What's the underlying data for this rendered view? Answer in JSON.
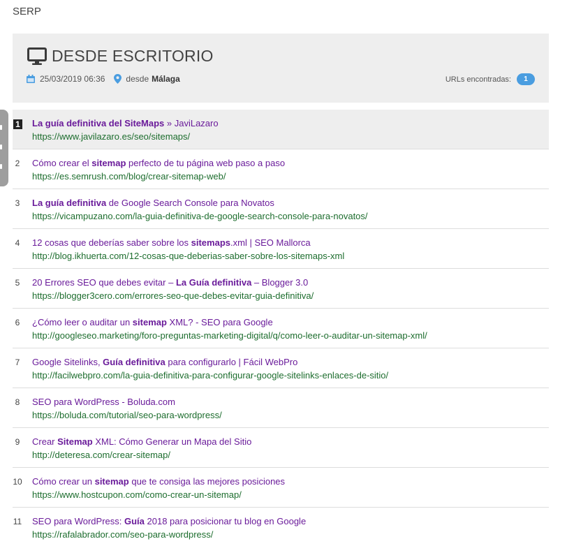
{
  "page": {
    "heading": "SERP"
  },
  "header": {
    "title": "DESDE ESCRITORIO",
    "date": "25/03/2019 06:36",
    "from_prefix": "desde",
    "location": "Málaga",
    "urls_label": "URLs encontradas:",
    "urls_count": "1"
  },
  "colors": {
    "badge": "#4a9de0",
    "title": "#6a1b9a",
    "url": "#1d6d2e",
    "panel": "#eeeeee"
  },
  "results": [
    {
      "number": "1",
      "title": [
        {
          "t": "La guía definitiva del SiteMaps",
          "b": true
        },
        {
          "t": " » JaviLazaro",
          "b": false
        }
      ],
      "url": "https://www.javilazaro.es/seo/sitemaps/"
    },
    {
      "number": "2",
      "title": [
        {
          "t": "Cómo crear el ",
          "b": false
        },
        {
          "t": "sitemap",
          "b": true
        },
        {
          "t": " perfecto de tu página web paso a paso",
          "b": false
        }
      ],
      "url": "https://es.semrush.com/blog/crear-sitemap-web/"
    },
    {
      "number": "3",
      "title": [
        {
          "t": "La guía definitiva",
          "b": true
        },
        {
          "t": " de Google Search Console para Novatos",
          "b": false
        }
      ],
      "url": "https://vicampuzano.com/la-guia-definitiva-de-google-search-console-para-novatos/"
    },
    {
      "number": "4",
      "title": [
        {
          "t": "12 cosas que deberías saber sobre los ",
          "b": false
        },
        {
          "t": "sitemaps",
          "b": true
        },
        {
          "t": ".xml | SEO Mallorca",
          "b": false
        }
      ],
      "url": "http://blog.ikhuerta.com/12-cosas-que-deberias-saber-sobre-los-sitemaps-xml"
    },
    {
      "number": "5",
      "title": [
        {
          "t": "20 Errores SEO que debes evitar – ",
          "b": false
        },
        {
          "t": "La Guía definitiva",
          "b": true
        },
        {
          "t": " – Blogger 3.0",
          "b": false
        }
      ],
      "url": "https://blogger3cero.com/errores-seo-que-debes-evitar-guia-definitiva/"
    },
    {
      "number": "6",
      "title": [
        {
          "t": "¿Cómo leer o auditar un ",
          "b": false
        },
        {
          "t": "sitemap",
          "b": true
        },
        {
          "t": " XML? - SEO para Google",
          "b": false
        }
      ],
      "url": "http://googleseo.marketing/foro-preguntas-marketing-digital/q/como-leer-o-auditar-un-sitemap-xml/"
    },
    {
      "number": "7",
      "title": [
        {
          "t": "Google Sitelinks, ",
          "b": false
        },
        {
          "t": "Guía definitiva",
          "b": true
        },
        {
          "t": " para configurarlo | Fácil WebPro",
          "b": false
        }
      ],
      "url": "http://facilwebpro.com/la-guia-definitiva-para-configurar-google-sitelinks-enlaces-de-sitio/"
    },
    {
      "number": "8",
      "title": [
        {
          "t": "SEO para WordPress - Boluda.com",
          "b": false
        }
      ],
      "url": "https://boluda.com/tutorial/seo-para-wordpress/"
    },
    {
      "number": "9",
      "title": [
        {
          "t": "Crear ",
          "b": false
        },
        {
          "t": "Sitemap",
          "b": true
        },
        {
          "t": " XML: Cómo Generar un Mapa del Sitio",
          "b": false
        }
      ],
      "url": "http://deteresa.com/crear-sitemap/"
    },
    {
      "number": "10",
      "title": [
        {
          "t": "Cómo crear un ",
          "b": false
        },
        {
          "t": "sitemap",
          "b": true
        },
        {
          "t": " que te consiga las mejores posiciones",
          "b": false
        }
      ],
      "url": "https://www.hostcupon.com/como-crear-un-sitemap/"
    },
    {
      "number": "11",
      "title": [
        {
          "t": "SEO para WordPress: ",
          "b": false
        },
        {
          "t": "Guía",
          "b": true
        },
        {
          "t": " 2018 para posicionar tu blog en Google",
          "b": false
        }
      ],
      "url": "https://rafalabrador.com/seo-para-wordpress/"
    }
  ]
}
